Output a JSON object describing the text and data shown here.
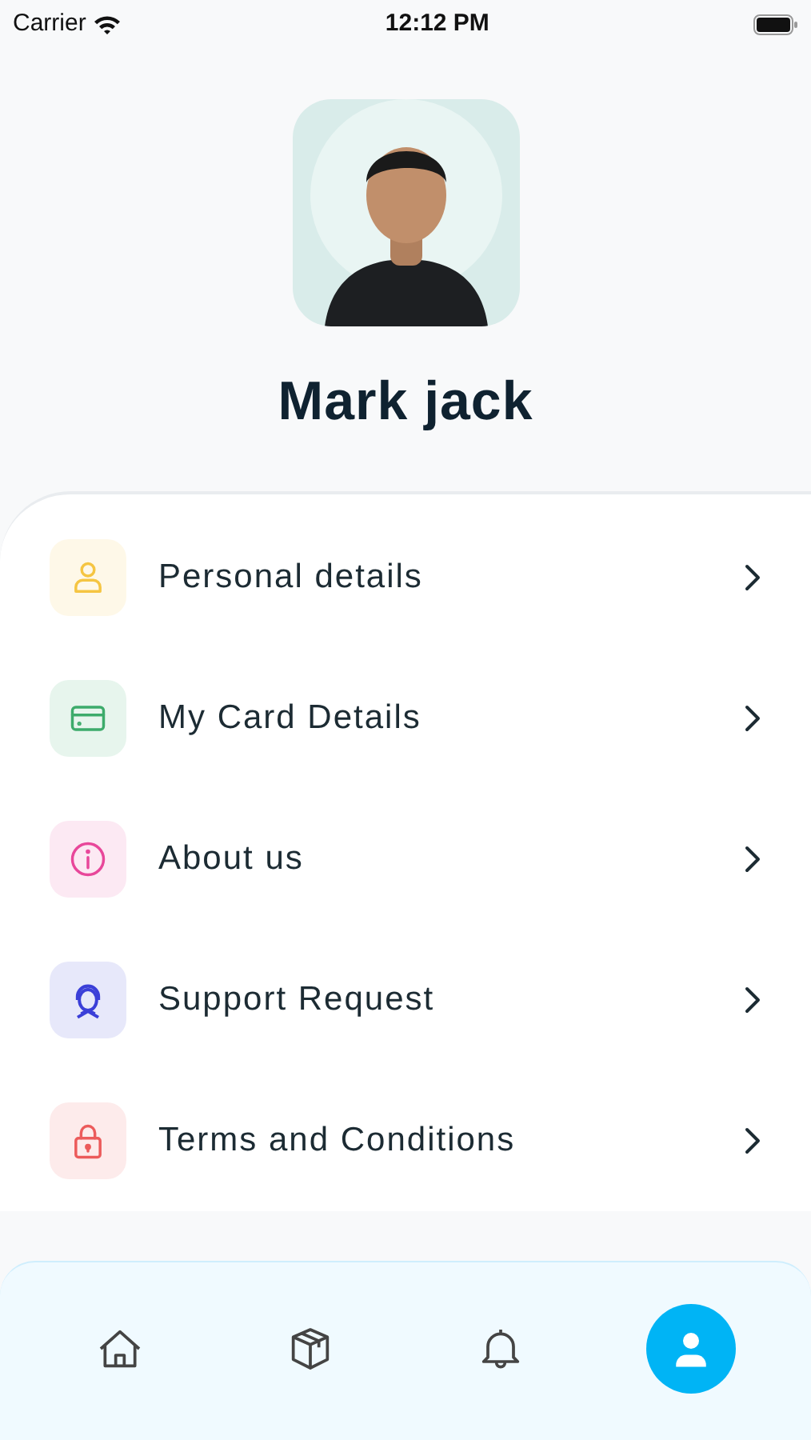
{
  "status_bar": {
    "carrier": "Carrier",
    "time": "12:12 PM"
  },
  "profile": {
    "name": "Mark jack"
  },
  "menu": [
    {
      "label": "Personal details",
      "color": "#f5c542"
    },
    {
      "label": "My Card Details",
      "color": "#3dab6b"
    },
    {
      "label": "About us",
      "color": "#e8479a"
    },
    {
      "label": "Support Request",
      "color": "#3b3fd8"
    },
    {
      "label": "Terms and Conditions",
      "color": "#ec5b5b"
    }
  ],
  "tab_bar": [
    {
      "selected": false
    },
    {
      "selected": false
    },
    {
      "selected": false
    },
    {
      "selected": true
    }
  ]
}
